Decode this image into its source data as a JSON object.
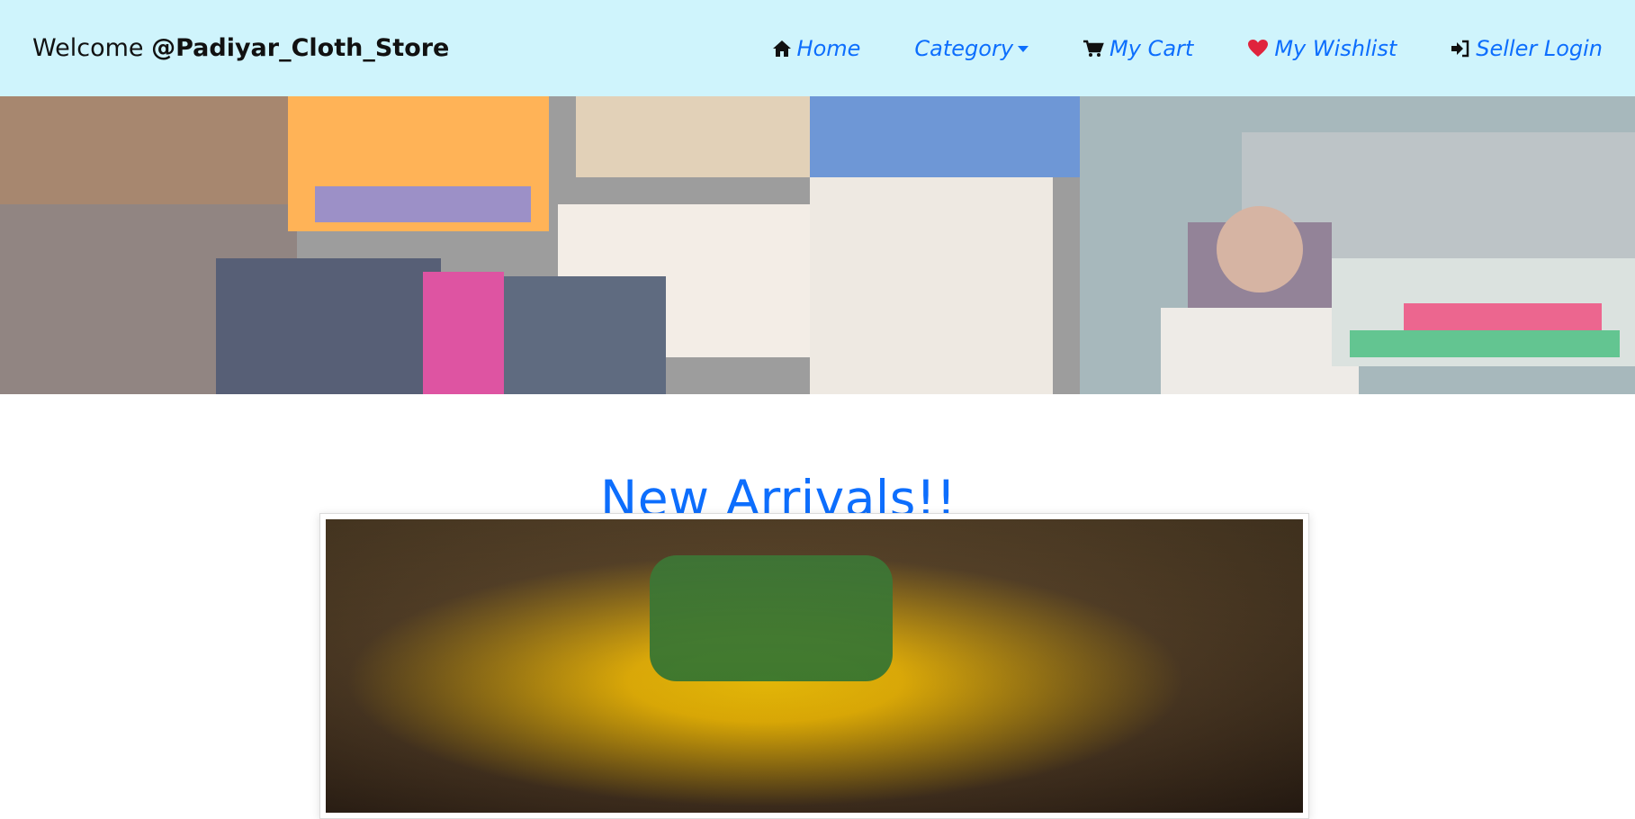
{
  "navbar": {
    "welcome_prefix": "Welcome ",
    "store_name": "@Padiyar_Cloth_Store",
    "items": [
      {
        "label": "Home",
        "icon": "home-icon"
      },
      {
        "label": "Category",
        "icon": "",
        "has_dropdown": true
      },
      {
        "label": "My Cart",
        "icon": "cart-icon"
      },
      {
        "label": "My Wishlist",
        "icon": "heart-icon"
      },
      {
        "label": "Seller Login",
        "icon": "sign-in-icon"
      }
    ]
  },
  "main": {
    "section_title": "New Arrivals!!"
  },
  "colors": {
    "navbar_bg": "#cff4fc",
    "link": "#0d6efd",
    "heart": "#e0243d"
  }
}
